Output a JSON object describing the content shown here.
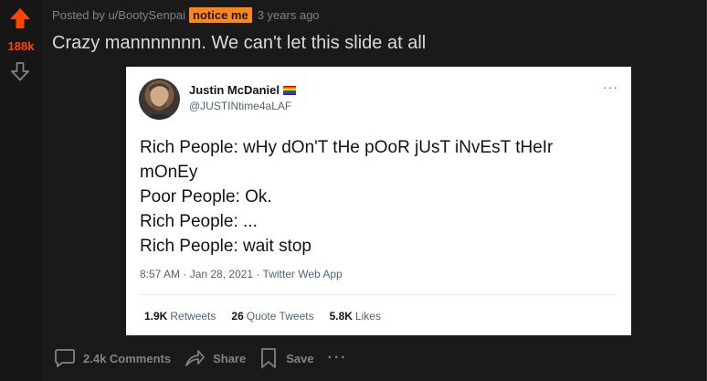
{
  "post": {
    "score": "188k",
    "posted_by_prefix": "Posted by",
    "author": "u/BootySenpai",
    "flair": "notice me",
    "age": "3 years ago",
    "title": "Crazy mannnnnnn. We can't let this slide at all"
  },
  "tweet": {
    "display_name": "Justin McDaniel",
    "handle": "@JUSTINtime4aLAF",
    "body_lines": [
      "Rich People: wHy dOn'T tHe pOoR jUsT iNvEsT tHeIr",
      "mOnEy",
      "Poor People: Ok.",
      "Rich People: ...",
      "Rich People: wait stop"
    ],
    "timestamp": "8:57 AM · Jan 28, 2021 · Twitter Web App",
    "stats": {
      "retweets_count": "1.9K",
      "retweets_label": "Retweets",
      "quotes_count": "26",
      "quotes_label": "Quote Tweets",
      "likes_count": "5.8K",
      "likes_label": "Likes"
    },
    "more_icon": "more-horizontal-icon"
  },
  "actions": {
    "comments_label": "2.4k Comments",
    "share_label": "Share",
    "save_label": "Save",
    "more_label": "···"
  },
  "colors": {
    "accent_upvote": "#ff4500",
    "flair_bg": "#ff8717",
    "post_bg": "#1a1a1b",
    "text_muted": "#818384"
  }
}
